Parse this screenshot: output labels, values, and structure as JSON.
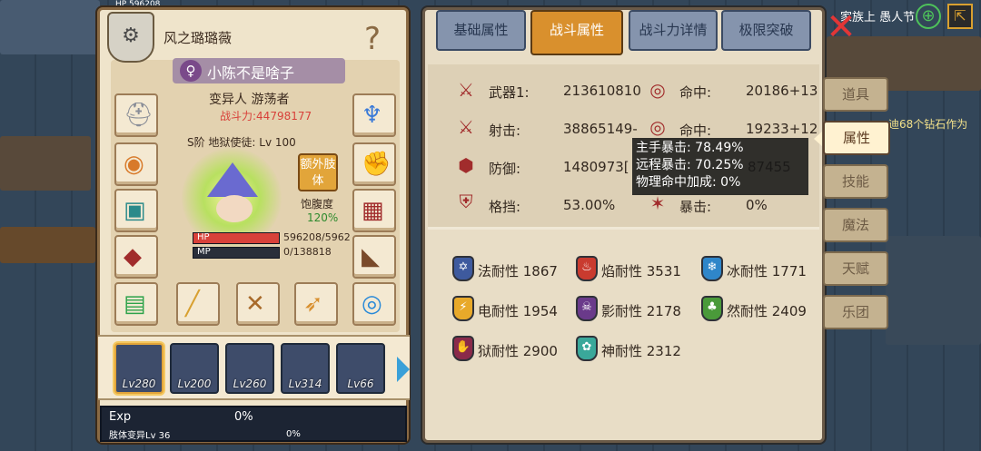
{
  "hud": {
    "topleft_hp": "HP 596208",
    "top_right_text": "家族上 愚人节",
    "notice": "迪68个钻石作为"
  },
  "character": {
    "name": "风之璐璐薇",
    "player": "小陈不是啥子",
    "class_line": "变异人 游荡者",
    "power": "战斗力:44798177",
    "rank_line": "S阶 地狱使徒: Lv 100",
    "extra_limb_button": "额外肢体",
    "satiety_label": "饱腹度",
    "satiety_value": "120%",
    "satiety_pct": 100,
    "hp_label": "HP",
    "hp_value": "596208/5962",
    "hp_fill": 1.0,
    "mp_label": "MP",
    "mp_value": "0/138818",
    "mp_fill": 0.0
  },
  "party": [
    {
      "lv": "Lv280"
    },
    {
      "lv": "Lv200"
    },
    {
      "lv": "Lv260"
    },
    {
      "lv": "Lv314"
    },
    {
      "lv": "Lv66"
    }
  ],
  "exp": {
    "label": "Exp",
    "value": "0%",
    "sub_label": "肢体变异Lv 36",
    "sub_value": "0%",
    "fill": 0
  },
  "tabs": [
    "基础属性",
    "战斗属性",
    "战斗力详情",
    "极限突破"
  ],
  "stats": {
    "weapon1_label": "武器1:",
    "weapon1_value": "213610810",
    "accuracy1_label": "命中:",
    "accuracy1_value": "20186+13",
    "shoot_label": "射击:",
    "shoot_value": "38865149-",
    "accuracy2_label": "命中:",
    "accuracy2_value": "19233+12",
    "defense_label": "防御:",
    "defense_value": "1480973[",
    "defense_extra": "87455",
    "block_label": "格挡:",
    "block_value": "53.00%",
    "crit_label": "暴击:",
    "crit_value": "0%"
  },
  "tooltip": [
    "主手暴击: 78.49%",
    "远程暴击: 70.25%",
    "物理命中加成: 0%"
  ],
  "resistances": [
    {
      "text": "法耐性 1867",
      "color": "#3e5a9e",
      "icon": "✡"
    },
    {
      "text": "焰耐性 3531",
      "color": "#c93b2f",
      "icon": "♨"
    },
    {
      "text": "冰耐性 1771",
      "color": "#2f86c9",
      "icon": "❄"
    },
    {
      "text": "电耐性 1954",
      "color": "#e8a92a",
      "icon": "⚡"
    },
    {
      "text": "影耐性 2178",
      "color": "#6a3a8a",
      "icon": "☠"
    },
    {
      "text": "然耐性 2409",
      "color": "#4a9a3a",
      "icon": "♣"
    },
    {
      "text": "狱耐性 2900",
      "color": "#8a2a4a",
      "icon": "✋"
    },
    {
      "text": "神耐性 2312",
      "color": "#3aa89a",
      "icon": "✿"
    }
  ],
  "side_menu": [
    "道具",
    "属性",
    "技能",
    "魔法",
    "天赋",
    "乐团"
  ],
  "colors": {
    "accent": "#d9902d",
    "hp": "#d8413a",
    "mp": "#3a63d8",
    "power": "#d8413a",
    "satiety": "#2e8a2e"
  }
}
